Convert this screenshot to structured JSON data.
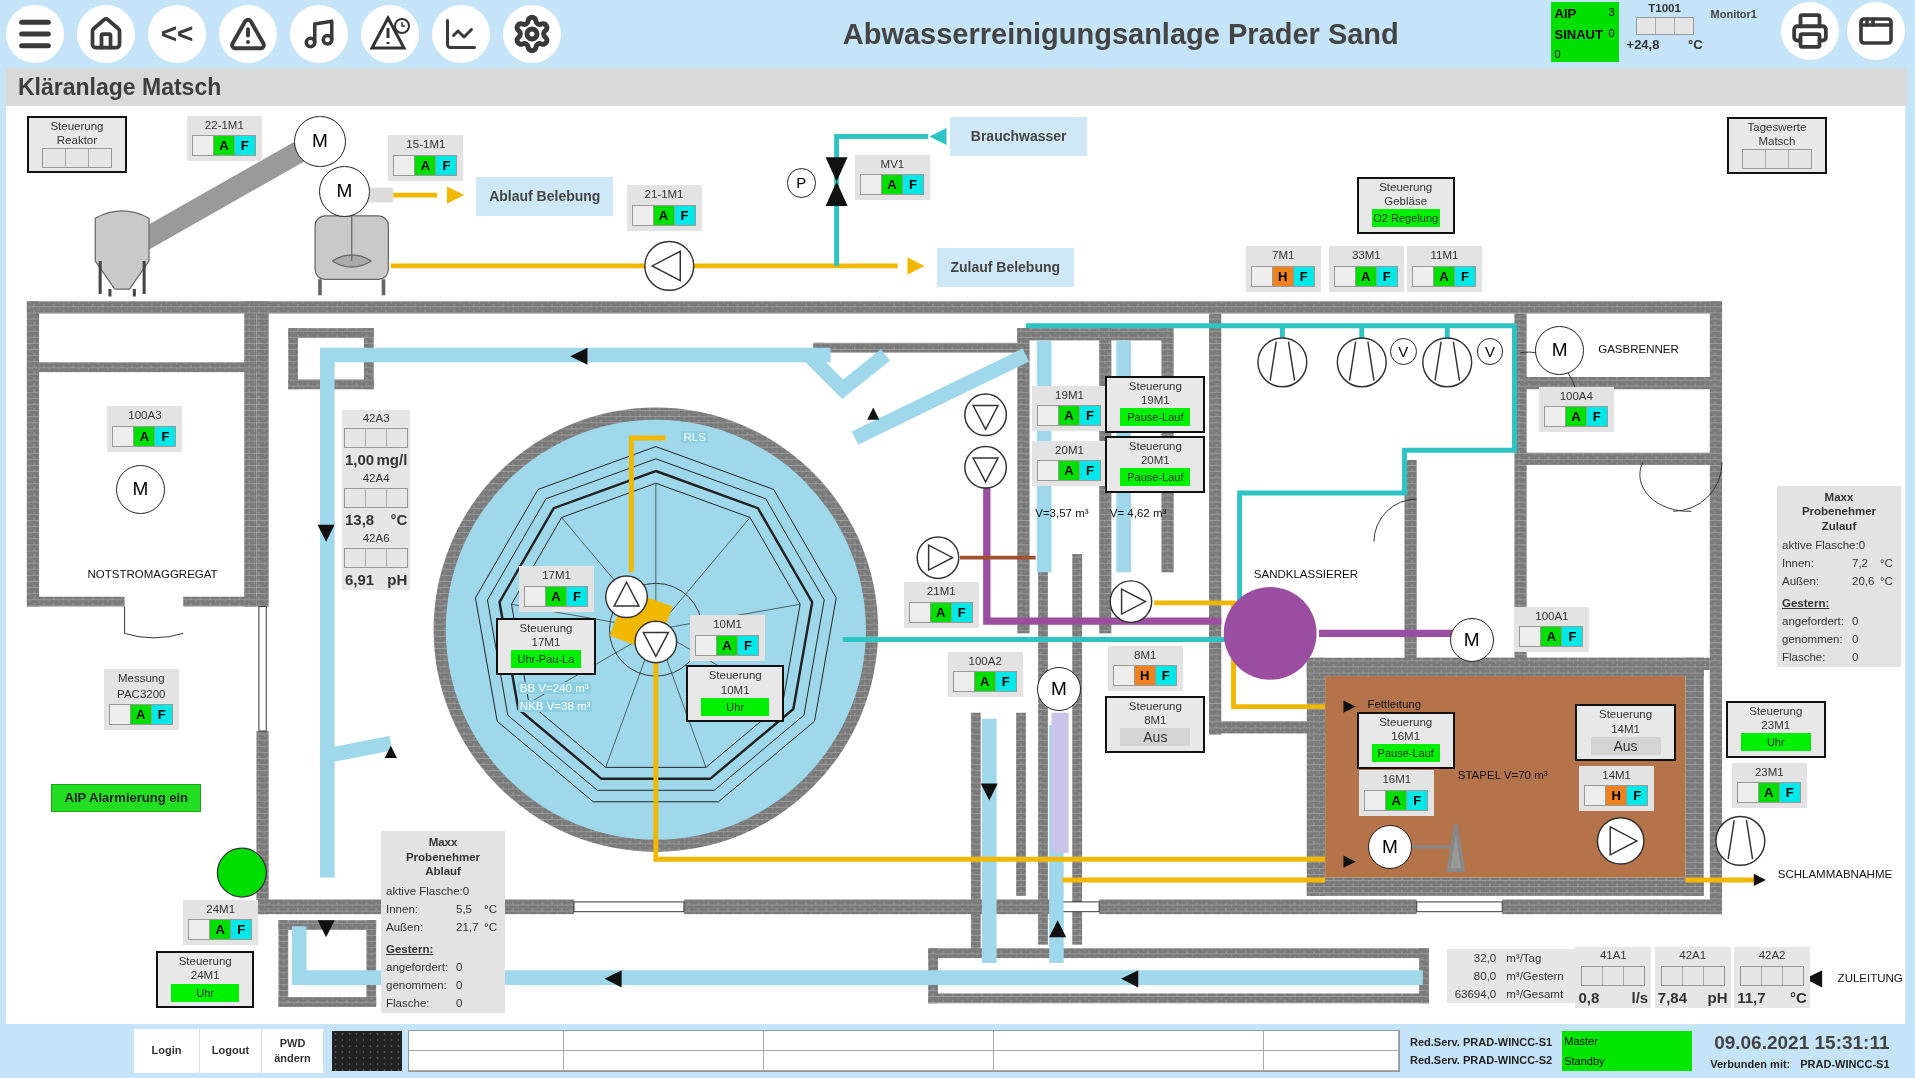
{
  "toolbar": {
    "buttons": [
      {
        "kind": "menu"
      },
      {
        "kind": "home"
      },
      {
        "kind": "back",
        "label": "<<"
      },
      {
        "kind": "alarm"
      },
      {
        "kind": "mute"
      },
      {
        "kind": "alarm-history"
      },
      {
        "kind": "trend"
      },
      {
        "kind": "settings"
      }
    ]
  },
  "title": "Abwasserreinigungsanlage Prader Sand",
  "aip_status": {
    "label": "AIP",
    "count": "3",
    "system": "SINAUT",
    "left_count": "0",
    "right_count": "0"
  },
  "temperature": {
    "tag": "T1001",
    "value": "+24,8",
    "unit": "°C"
  },
  "monitor": "Monitor1",
  "page_title": "Kläranlage Matsch",
  "motors": [
    {
      "title": [
        "22-1M1"
      ],
      "mode": "A",
      "hand": false,
      "fault": "F"
    },
    {
      "title": [
        "15-1M1"
      ],
      "mode": "A",
      "hand": false,
      "fault": "F"
    },
    {
      "title": [
        "21-1M1"
      ],
      "mode": "A",
      "hand": false,
      "fault": "F"
    },
    {
      "title": [
        "MV1"
      ],
      "mode": "A",
      "hand": false,
      "fault": "F"
    },
    {
      "title": [
        "7M1"
      ],
      "mode": "H",
      "hand": true,
      "fault": "F"
    },
    {
      "title": [
        "33M1"
      ],
      "mode": "A",
      "hand": false,
      "fault": "F"
    },
    {
      "title": [
        "11M1"
      ],
      "mode": "A",
      "hand": false,
      "fault": "F"
    },
    {
      "title": [
        "100A3"
      ],
      "mode": "A",
      "hand": false,
      "fault": "F"
    },
    {
      "title": [
        "19M1"
      ],
      "mode": "A",
      "hand": false,
      "fault": "F"
    },
    {
      "title": [
        "20M1"
      ],
      "mode": "A",
      "hand": false,
      "fault": "F"
    },
    {
      "title": [
        "100A4"
      ],
      "mode": "A",
      "hand": false,
      "fault": "F"
    },
    {
      "title": [
        "17M1"
      ],
      "mode": "A",
      "hand": false,
      "fault": "F"
    },
    {
      "title": [
        "10M1"
      ],
      "mode": "A",
      "hand": false,
      "fault": "F"
    },
    {
      "title": [
        "21M1"
      ],
      "mode": "A",
      "hand": false,
      "fault": "F"
    },
    {
      "title": [
        "100A2"
      ],
      "mode": "A",
      "hand": false,
      "fault": "F"
    },
    {
      "title": [
        "8M1"
      ],
      "mode": "H",
      "hand": true,
      "fault": "F"
    },
    {
      "title": [
        "100A1"
      ],
      "mode": "A",
      "hand": false,
      "fault": "F"
    },
    {
      "title": [
        "16M1"
      ],
      "mode": "A",
      "hand": false,
      "fault": "F"
    },
    {
      "title": [
        "14M1"
      ],
      "mode": "H",
      "hand": true,
      "fault": "F"
    },
    {
      "title": [
        "23M1"
      ],
      "mode": "A",
      "hand": false,
      "fault": "F"
    },
    {
      "title": [
        "Messung",
        "PAC3200"
      ],
      "mode": "A",
      "hand": false,
      "fault": "F"
    },
    {
      "title": [
        "24M1"
      ],
      "mode": "A",
      "hand": false,
      "fault": "F"
    }
  ],
  "controls": [
    {
      "title": [
        "Steuerung",
        "Reaktor"
      ],
      "kind": "cells"
    },
    {
      "title": [
        "Steuerung",
        "Gebläse"
      ],
      "kind": "green",
      "value": "O2 Regelung"
    },
    {
      "title": [
        "Tageswerte",
        "Matsch"
      ],
      "kind": "cells"
    },
    {
      "title": [
        "Steuerung",
        "19M1"
      ],
      "kind": "green",
      "value": "Pause-Lauf"
    },
    {
      "title": [
        "Steuerung",
        "20M1"
      ],
      "kind": "green",
      "value": "Pause-Lauf"
    },
    {
      "title": [
        "Steuerung",
        "17M1"
      ],
      "kind": "green",
      "value": "Uhr-Pau-La"
    },
    {
      "title": [
        "Steuerung",
        "10M1"
      ],
      "kind": "green",
      "value": "Uhr"
    },
    {
      "title": [
        "Steuerung",
        "8M1"
      ],
      "kind": "grey",
      "value": "Aus"
    },
    {
      "title": [
        "Steuerung",
        "16M1"
      ],
      "kind": "green",
      "value": "Pause-Lauf"
    },
    {
      "title": [
        "Steuerung",
        "14M1"
      ],
      "kind": "grey",
      "value": "Aus"
    },
    {
      "title": [
        "Steuerung",
        "23M1"
      ],
      "kind": "green",
      "value": "Uhr"
    },
    {
      "title": [
        "Steuerung",
        "24M1"
      ],
      "kind": "green",
      "value": "Uhr"
    }
  ],
  "flow_labels": [
    "Ablauf Belebung",
    "Brauchwasser",
    "Zulauf Belebung"
  ],
  "labels": [
    {
      "text": "NOTSTROMAGGREGAT",
      "kind": "dark"
    },
    {
      "text": "GASBRENNER",
      "kind": "dark"
    },
    {
      "text": "SANDKLASSIERER",
      "kind": "dark"
    },
    {
      "text": "Fettleitung",
      "kind": "dark"
    },
    {
      "text": "STAPEL V=70 m³",
      "kind": "dark"
    },
    {
      "text": "SCHLAMMABNAHME",
      "kind": "dark"
    },
    {
      "text": "ZULEITUNG",
      "kind": "dark"
    },
    {
      "text": "V=3,57 m³",
      "kind": "dark"
    },
    {
      "text": "V= 4,62 m³",
      "kind": "dark"
    },
    {
      "text": "BB V=240 m³",
      "kind": "light"
    },
    {
      "text": "NKB V=38 m³",
      "kind": "light"
    },
    {
      "text": "RLS",
      "kind": "light"
    }
  ],
  "symbols": [
    {
      "letter": "M"
    },
    {
      "letter": "M"
    },
    {
      "letter": "P"
    },
    {
      "letter": "M"
    },
    {
      "letter": "V"
    },
    {
      "letter": "V"
    },
    {
      "letter": "M"
    },
    {
      "letter": "M"
    },
    {
      "letter": "M"
    },
    {
      "letter": "M"
    }
  ],
  "analyzers": [
    {
      "tag": "42A3",
      "value": "1,00",
      "unit": "mg/l"
    },
    {
      "tag": "42A4",
      "value": "13,8",
      "unit": "°C"
    },
    {
      "tag": "42A6",
      "value": "6,91",
      "unit": "pH"
    },
    {
      "tag": "41A1",
      "value": "0,8",
      "unit": "l/s"
    },
    {
      "tag": "42A1",
      "value": "7,84",
      "unit": "pH"
    },
    {
      "tag": "42A2",
      "value": "11,7",
      "unit": "°C"
    }
  ],
  "counters": [
    {
      "value": "32,0",
      "unit": "m³/Tag"
    },
    {
      "value": "80,0",
      "unit": "m³/Gestern"
    },
    {
      "value": "63694,0",
      "unit": "m³/Gesamt"
    }
  ],
  "samplers": [
    {
      "title": [
        "Maxx",
        "Probenehmer",
        "Zulauf"
      ],
      "rows": [
        {
          "label": "aktive Flasche:",
          "value": "0"
        },
        {
          "label": "Innen:",
          "value": "7,2",
          "unit": "°C"
        },
        {
          "label": "Außen:",
          "value": "20,6",
          "unit": "°C"
        }
      ],
      "yesterday": "Gestern:",
      "yesterday_rows": [
        {
          "label": "angefordert:",
          "value": "0"
        },
        {
          "label": "genommen:",
          "value": "0"
        },
        {
          "label": "Flasche:",
          "value": "0"
        }
      ]
    },
    {
      "title": [
        "Maxx",
        "Probenehmer",
        "Ablauf"
      ],
      "rows": [
        {
          "label": "aktive Flasche:",
          "value": "0"
        },
        {
          "label": "Innen:",
          "value": "5,5",
          "unit": "°C"
        },
        {
          "label": "Außen:",
          "value": "21,7",
          "unit": "°C"
        }
      ],
      "yesterday": "Gestern:",
      "yesterday_rows": [
        {
          "label": "angefordert:",
          "value": "0"
        },
        {
          "label": "genommen:",
          "value": "0"
        },
        {
          "label": "Flasche:",
          "value": "0"
        }
      ]
    }
  ],
  "alarm_button": "AIP Alarmierung ein",
  "footer": {
    "buttons": [
      "Login",
      "Logout",
      "PWD ändern"
    ],
    "servers": [
      {
        "label": "Red.Serv. PRAD-WINCC-S1",
        "role": "Master"
      },
      {
        "label": "Red.Serv. PRAD-WINCC-S2",
        "role": "Standby"
      }
    ],
    "datetime": "09.06.2021 15:31:11",
    "connected_label": "Verbunden mit:",
    "connected_server": "PRAD-WINCC-S1"
  }
}
